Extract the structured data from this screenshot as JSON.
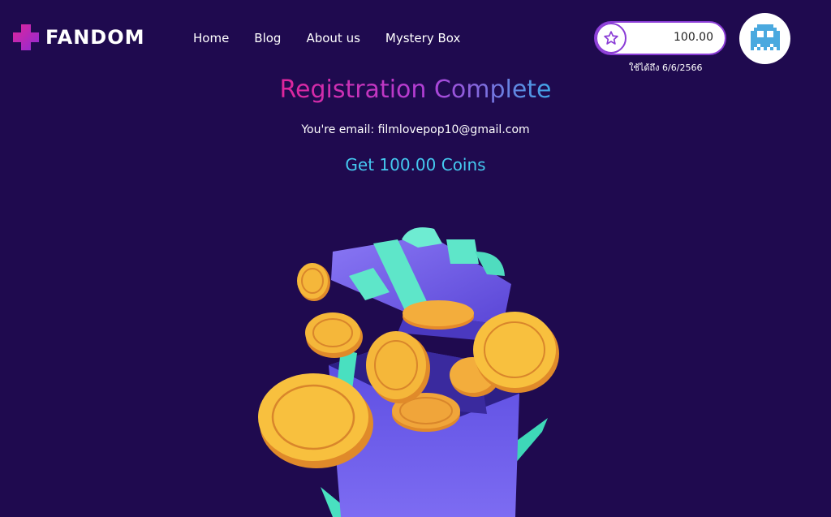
{
  "nav": {
    "brand": "FANDOM",
    "menu": [
      {
        "label": "Home"
      },
      {
        "label": "Blog"
      },
      {
        "label": "About us"
      },
      {
        "label": "Mystery Box"
      }
    ]
  },
  "wallet": {
    "icon": "star-icon",
    "amount": "100.00",
    "expiry": "ใช้ได้ถึง 6/6/2566"
  },
  "avatar": {
    "icon": "pixel-ghost-icon"
  },
  "main": {
    "title": "Registration Complete",
    "email_line": "You're email: filmlovepop10@gmail.com",
    "reward": "Get 100.00 Coins"
  },
  "colors": {
    "background": "#1f0a4f",
    "brand_plus_start": "#e0259a",
    "brand_plus_end": "#8e2bd6",
    "reward_text": "#45c9f0",
    "coin": "#f5b73a"
  }
}
